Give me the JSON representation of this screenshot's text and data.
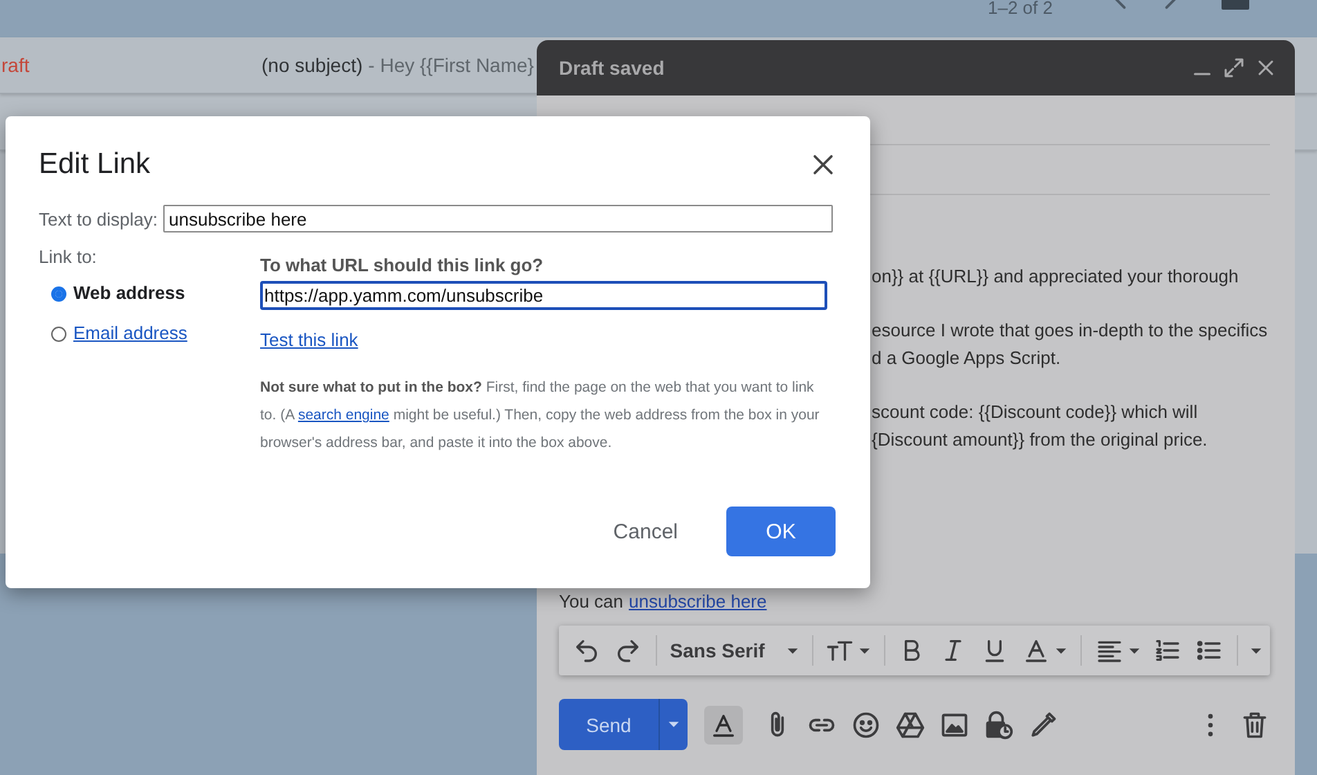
{
  "top_bar": {
    "page_count": "1–2 of 2"
  },
  "email_list": {
    "rows": [
      {
        "label": "raft",
        "subject": "(no subject)",
        "snippet": "- Hey {{First Name}"
      }
    ]
  },
  "compose": {
    "title": "Draft saved",
    "body_paragraphs": [
      [
        "on}} at {{URL}} and appreciated your thorough"
      ],
      [
        "esource I wrote that goes in-depth to the specifics",
        "d a Google Apps Script."
      ],
      [
        "scount code: {{Discount code}} which will",
        "{Discount amount}} from the original price."
      ]
    ],
    "closing": {
      "text": "You can",
      "link": "unsubscribe here"
    },
    "toolbar": {
      "font": "Sans Serif"
    },
    "send_label": "Send"
  },
  "dialog": {
    "title": "Edit Link",
    "display_label": "Text to display:",
    "display_value": "unsubscribe here",
    "link_to_label": "Link to:",
    "link_types": [
      {
        "label": "Web address",
        "selected": true
      },
      {
        "label": "Email address",
        "selected": false
      }
    ],
    "url_heading": "To what URL should this link go?",
    "url_value": "https://app.yamm.com/unsubscribe",
    "test_link": "Test this link",
    "help": "**Not sure what to put in the box?** First, find the page on the web that you want to link to. (A ",
    "help_link": "search engine",
    "help_end": " might be useful.) Then, copy the web address from the box in your browser's address bar, and paste it into the box above.",
    "buttons": [
      {
        "label": "Cancel",
        "kind": "secondary"
      },
      {
        "label": "OK",
        "kind": "primary"
      }
    ]
  }
}
